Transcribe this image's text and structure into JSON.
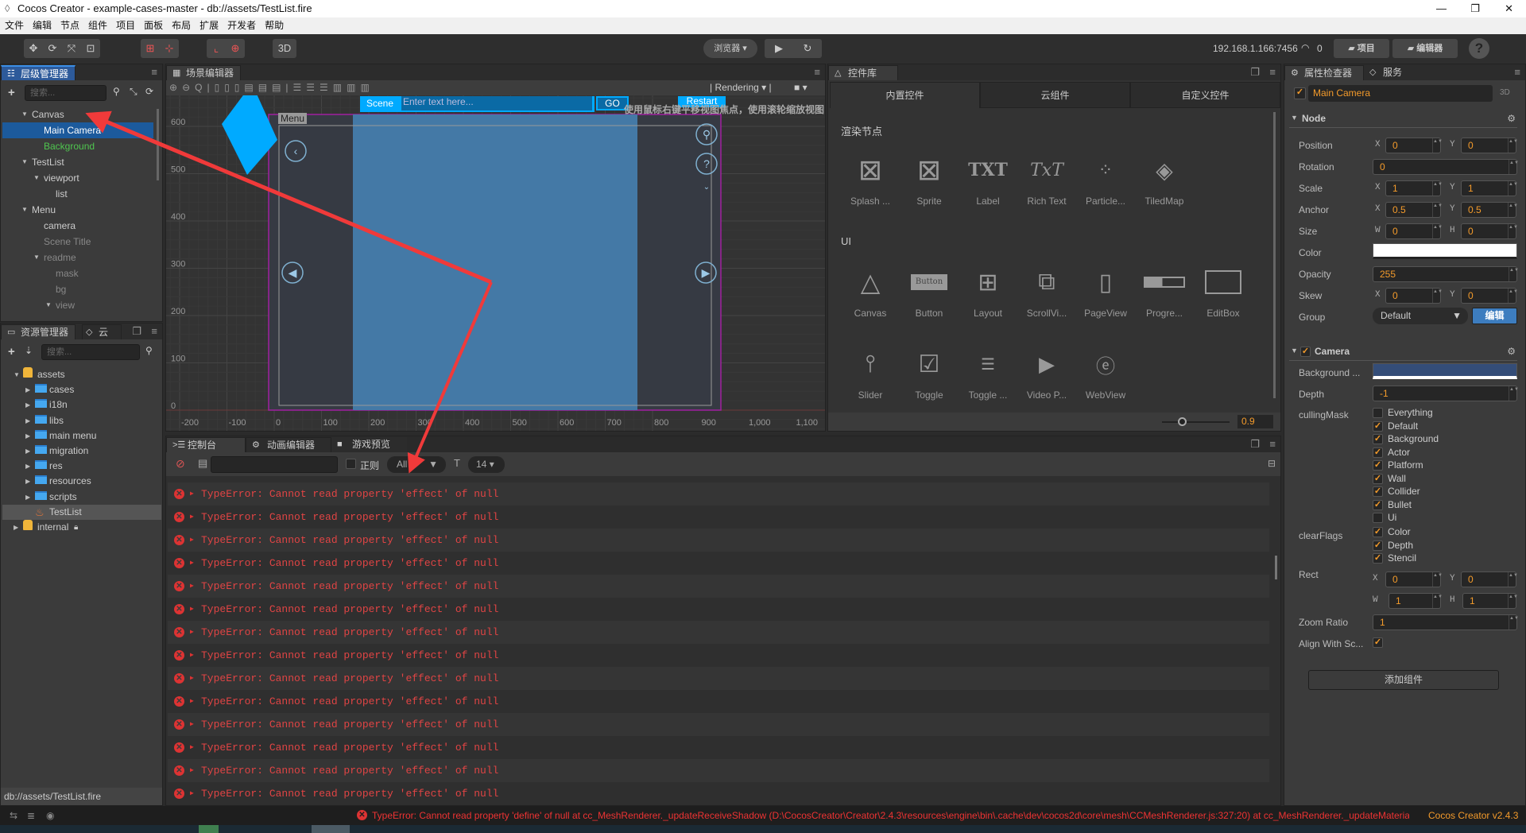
{
  "window": {
    "title": "Cocos Creator - example-cases-master - db://assets/TestList.fire"
  },
  "menu": [
    "文件",
    "编辑",
    "节点",
    "组件",
    "项目",
    "面板",
    "布局",
    "扩展",
    "开发者",
    "帮助"
  ],
  "toolbar": {
    "mode_3d": "3D",
    "preview_select": "浏览器 ▾",
    "ip": "192.168.1.166:7456",
    "connections": "0",
    "project_btn": "项目",
    "editor_btn": "编辑器",
    "help": "?"
  },
  "hierarchy": {
    "tab": "层级管理器",
    "search_placeholder": "搜索...",
    "items": [
      {
        "label": "Canvas",
        "level": 0,
        "arrow": true,
        "style": "normal"
      },
      {
        "label": "Main Camera",
        "level": 1,
        "arrow": false,
        "style": "selected"
      },
      {
        "label": "Background",
        "level": 1,
        "arrow": false,
        "style": "green"
      },
      {
        "label": "TestList",
        "level": 0,
        "arrow": true,
        "style": "normal"
      },
      {
        "label": "viewport",
        "level": 1,
        "arrow": true,
        "style": "normal"
      },
      {
        "label": "list",
        "level": 2,
        "arrow": false,
        "style": "normal"
      },
      {
        "label": "Menu",
        "level": 0,
        "arrow": true,
        "style": "normal"
      },
      {
        "label": "camera",
        "level": 1,
        "arrow": false,
        "style": "normal"
      },
      {
        "label": "Scene Title",
        "level": 1,
        "arrow": false,
        "style": "dim"
      },
      {
        "label": "readme",
        "level": 1,
        "arrow": true,
        "style": "dim"
      },
      {
        "label": "mask",
        "level": 2,
        "arrow": false,
        "style": "dim"
      },
      {
        "label": "bg",
        "level": 2,
        "arrow": false,
        "style": "dim"
      },
      {
        "label": "view",
        "level": 2,
        "arrow": true,
        "style": "dim"
      }
    ]
  },
  "assets": {
    "tab": "资源管理器",
    "tab2": "云函",
    "search_placeholder": "搜索...",
    "items": [
      {
        "label": "assets",
        "level": 0,
        "type": "db",
        "expanded": true
      },
      {
        "label": "cases",
        "level": 1,
        "type": "folder"
      },
      {
        "label": "i18n",
        "level": 1,
        "type": "folder"
      },
      {
        "label": "libs",
        "level": 1,
        "type": "folder"
      },
      {
        "label": "main menu",
        "level": 1,
        "type": "folder"
      },
      {
        "label": "migration",
        "level": 1,
        "type": "folder"
      },
      {
        "label": "res",
        "level": 1,
        "type": "folder"
      },
      {
        "label": "resources",
        "level": 1,
        "type": "folder"
      },
      {
        "label": "scripts",
        "level": 1,
        "type": "folder"
      },
      {
        "label": "TestList",
        "level": 1,
        "type": "scene",
        "selected": true
      },
      {
        "label": "internal",
        "level": 0,
        "type": "db",
        "locked": true
      }
    ],
    "path": "db://assets/TestList.fire"
  },
  "scene": {
    "tab": "场景编辑器",
    "rendering": "Rendering",
    "hint": "使用鼠标右键平移视图焦点，使用滚轮缩放视图",
    "x_ticks": [
      "-200",
      "-100",
      "0",
      "100",
      "200",
      "300",
      "400",
      "500",
      "600",
      "700",
      "800",
      "900",
      "1,000",
      "1,100"
    ],
    "y_ticks": [
      "600",
      "500",
      "400",
      "300",
      "200",
      "100",
      "0"
    ],
    "game_ui": {
      "scene_label": "Scene",
      "input_placeholder": "Enter text here...",
      "go": "GO",
      "restart": "Restart",
      "menu": "Menu"
    },
    "colors": {
      "design_border": "#a020a0",
      "panel": "#4479a6",
      "accent": "#00aaff"
    }
  },
  "widgets": {
    "tab": "控件库",
    "tabs": [
      "内置控件",
      "云组件",
      "自定义控件"
    ],
    "section_render": "渲染节点",
    "render_items": [
      {
        "label": "Splash ...",
        "icon": "sprite-splash-icon"
      },
      {
        "label": "Sprite",
        "icon": "sprite-icon"
      },
      {
        "label": "Label",
        "icon": "label-txt-icon"
      },
      {
        "label": "Rich Text",
        "icon": "richtext-icon"
      },
      {
        "label": "Particle...",
        "icon": "particle-icon"
      },
      {
        "label": "TiledMap",
        "icon": "tiledmap-icon"
      }
    ],
    "section_ui": "UI",
    "ui_items": [
      {
        "label": "Canvas",
        "icon": "canvas-icon"
      },
      {
        "label": "Button",
        "icon": "button-icon",
        "inner": "Button"
      },
      {
        "label": "Layout",
        "icon": "layout-icon"
      },
      {
        "label": "ScrollVi...",
        "icon": "scrollview-icon"
      },
      {
        "label": "PageView",
        "icon": "pageview-icon"
      },
      {
        "label": "Progre...",
        "icon": "progressbar-icon"
      },
      {
        "label": "EditBox",
        "icon": "editbox-icon"
      },
      {
        "label": "Slider",
        "icon": "slider-icon"
      },
      {
        "label": "Toggle",
        "icon": "toggle-icon"
      },
      {
        "label": "Toggle ...",
        "icon": "togglegroup-icon"
      },
      {
        "label": "Video P...",
        "icon": "videoplayer-icon"
      },
      {
        "label": "WebView",
        "icon": "webview-icon"
      }
    ],
    "scale_value": "0.9"
  },
  "console": {
    "tabs": [
      "控制台",
      "动画编辑器",
      "游戏预览"
    ],
    "regex_label": "正则",
    "level_select": "All",
    "font_size": "14",
    "messages": [
      "TypeError: Cannot read property 'effect' of null",
      "TypeError: Cannot read property 'effect' of null",
      "TypeError: Cannot read property 'effect' of null",
      "TypeError: Cannot read property 'effect' of null",
      "TypeError: Cannot read property 'effect' of null",
      "TypeError: Cannot read property 'effect' of null",
      "TypeError: Cannot read property 'effect' of null",
      "TypeError: Cannot read property 'effect' of null",
      "TypeError: Cannot read property 'effect' of null",
      "TypeError: Cannot read property 'effect' of null",
      "TypeError: Cannot read property 'effect' of null",
      "TypeError: Cannot read property 'effect' of null",
      "TypeError: Cannot read property 'effect' of null",
      "TypeError: Cannot read property 'effect' of null"
    ]
  },
  "inspector": {
    "tab": "属性检查器",
    "tab2": "服务",
    "node_name": "Main Camera",
    "mode": "3D",
    "node_section": "Node",
    "position": {
      "label": "Position",
      "x": "0",
      "y": "0"
    },
    "rotation": {
      "label": "Rotation",
      "value": "0"
    },
    "scale": {
      "label": "Scale",
      "x": "1",
      "y": "1"
    },
    "anchor": {
      "label": "Anchor",
      "x": "0.5",
      "y": "0.5"
    },
    "size": {
      "label": "Size",
      "w": "0",
      "h": "0"
    },
    "color": {
      "label": "Color",
      "value": "#ffffff"
    },
    "opacity": {
      "label": "Opacity",
      "value": "255"
    },
    "skew": {
      "label": "Skew",
      "x": "0",
      "y": "0"
    },
    "group": {
      "label": "Group",
      "value": "Default",
      "edit": "编辑"
    },
    "camera_section": "Camera",
    "background_color": {
      "label": "Background ...",
      "value": "#344d78"
    },
    "depth": {
      "label": "Depth",
      "value": "-1"
    },
    "culling_mask": {
      "label": "cullingMask",
      "options": [
        {
          "label": "Everything",
          "checked": false
        },
        {
          "label": "Default",
          "checked": true
        },
        {
          "label": "Background",
          "checked": true
        },
        {
          "label": "Actor",
          "checked": true
        },
        {
          "label": "Platform",
          "checked": true
        },
        {
          "label": "Wall",
          "checked": true
        },
        {
          "label": "Collider",
          "checked": true
        },
        {
          "label": "Bullet",
          "checked": true
        },
        {
          "label": "Ui",
          "checked": false
        }
      ]
    },
    "clear_flags": {
      "label": "clearFlags",
      "options": [
        {
          "label": "Color",
          "checked": true
        },
        {
          "label": "Depth",
          "checked": true
        },
        {
          "label": "Stencil",
          "checked": true
        }
      ]
    },
    "rect": {
      "label": "Rect",
      "x": "0",
      "y": "0",
      "w": "1",
      "h": "1"
    },
    "zoom_ratio": {
      "label": "Zoom Ratio",
      "value": "1"
    },
    "align_with_screen": {
      "label": "Align With Sc...",
      "checked": true
    },
    "add_component": "添加组件"
  },
  "statusbar": {
    "error": "TypeError: Cannot read property 'define' of null at cc_MeshRenderer._updateReceiveShadow (D:\\CocosCreator\\Creator\\2.4.3\\resources\\engine\\bin\\.cache\\dev\\cocos2d\\core\\mesh\\CCMeshRenderer.js:327:20) at cc_MeshRenderer._updateMaterial",
    "version": "Cocos Creator v2.4.3"
  }
}
